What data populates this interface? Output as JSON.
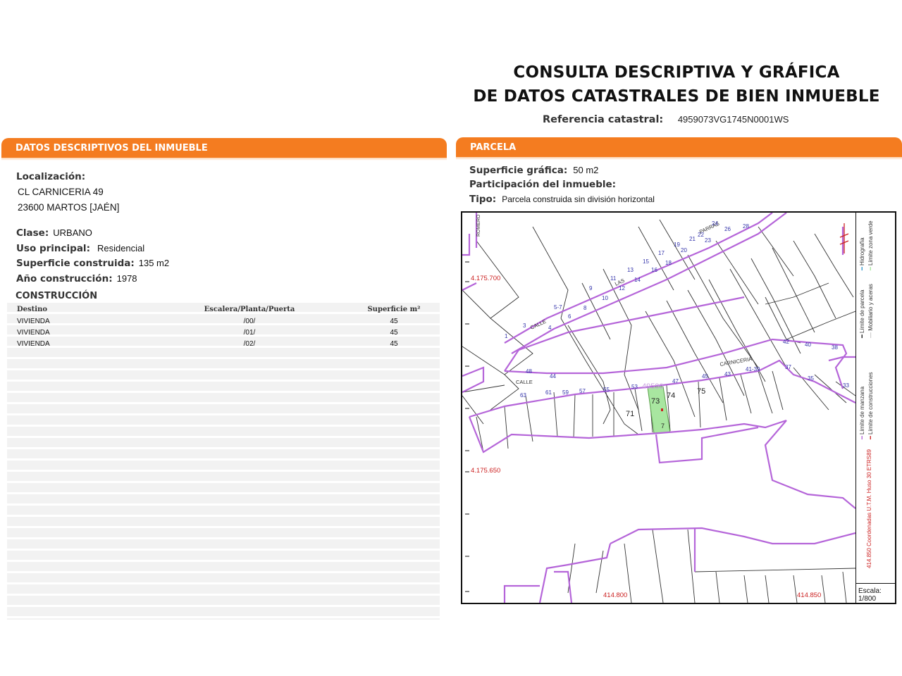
{
  "header": {
    "title_line1": "CONSULTA DESCRIPTIVA Y GRÁFICA",
    "title_line2": "DE DATOS CATASTRALES DE BIEN INMUEBLE",
    "ref_label": "Referencia catastral:",
    "ref_value": "4959073VG1745N0001WS"
  },
  "left_panel": {
    "heading": "DATOS DESCRIPTIVOS DEL INMUEBLE",
    "localizacion_label": "Localización:",
    "address_line1": "CL CARNICERIA 49",
    "address_line2": "23600 MARTOS [JAÉN]",
    "clase_label": "Clase:",
    "clase_value": "URBANO",
    "uso_label": "Uso principal:",
    "uso_value": "Residencial",
    "superficie_label": "Superficie construida:",
    "superficie_value": "135 m2",
    "anio_label": "Año construcción:",
    "anio_value": "1978",
    "construccion_title": "CONSTRUCCIÓN",
    "table": {
      "columns": [
        "Destino",
        "Escalera/Planta/Puerta",
        "Superficie m²"
      ],
      "rows": [
        [
          "VIVIENDA",
          "/00/",
          "45"
        ],
        [
          "VIVIENDA",
          "/01/",
          "45"
        ],
        [
          "VIVIENDA",
          "/02/",
          "45"
        ]
      ]
    }
  },
  "right_panel": {
    "heading": "PARCELA",
    "sup_grafica_label": "Superficie gráfica:",
    "sup_grafica_value": "50 m2",
    "participacion_label": "Participación del inmueble:",
    "tipo_label": "Tipo:",
    "tipo_value": "Parcela construida sin división horizontal"
  },
  "map": {
    "coord_top": "4.175.700",
    "coord_mid": "4.175.650",
    "coord_bottom_left": "414.800",
    "coord_bottom_right": "414.850",
    "street_calle_upper": "CALLE",
    "street_las": "LAS",
    "street_parras": "PARRAS",
    "street_romero": "ROMERO",
    "street_calle_lower": "CALLE",
    "street_carniceria": "CARNICERIA",
    "parcel_ref": "49590",
    "parcel_73": "73",
    "parcel_74": "74",
    "parcel_75": "75",
    "parcel_71": "71",
    "parcel_7": "7",
    "numbers_upper_street": [
      "1",
      "3",
      "4",
      "5-7",
      "6",
      "8",
      "9",
      "10",
      "11",
      "12",
      "13",
      "14",
      "15",
      "16",
      "17",
      "18",
      "19",
      "20",
      "21",
      "22",
      "23",
      "24",
      "26",
      "28"
    ],
    "numbers_lower_street": [
      "48",
      "44",
      "63",
      "61",
      "59",
      "57",
      "55",
      "53",
      "47",
      "45",
      "43",
      "41-39",
      "42",
      "40",
      "38",
      "37",
      "35",
      "33"
    ],
    "legend_col1a": "Límite de manzana",
    "legend_col1b": "Límite de parcela",
    "legend_col1c": "Hidrografía",
    "legend_col2a": "Límite de construcciones",
    "legend_col2b": "Mobiliario y aceras",
    "legend_col2c": "Límite zona verde",
    "legend_coords": "414.850 Coordenadas U.T.M. Huso 30 ETRS89",
    "escala_label": "Escala:",
    "escala_value": "1/800",
    "colors": {
      "manzana": "#b565d9",
      "construccion": "#333333",
      "zona_verde": "#a8e6a0",
      "coords": "#cc2222",
      "numbers": "#3333aa"
    }
  }
}
